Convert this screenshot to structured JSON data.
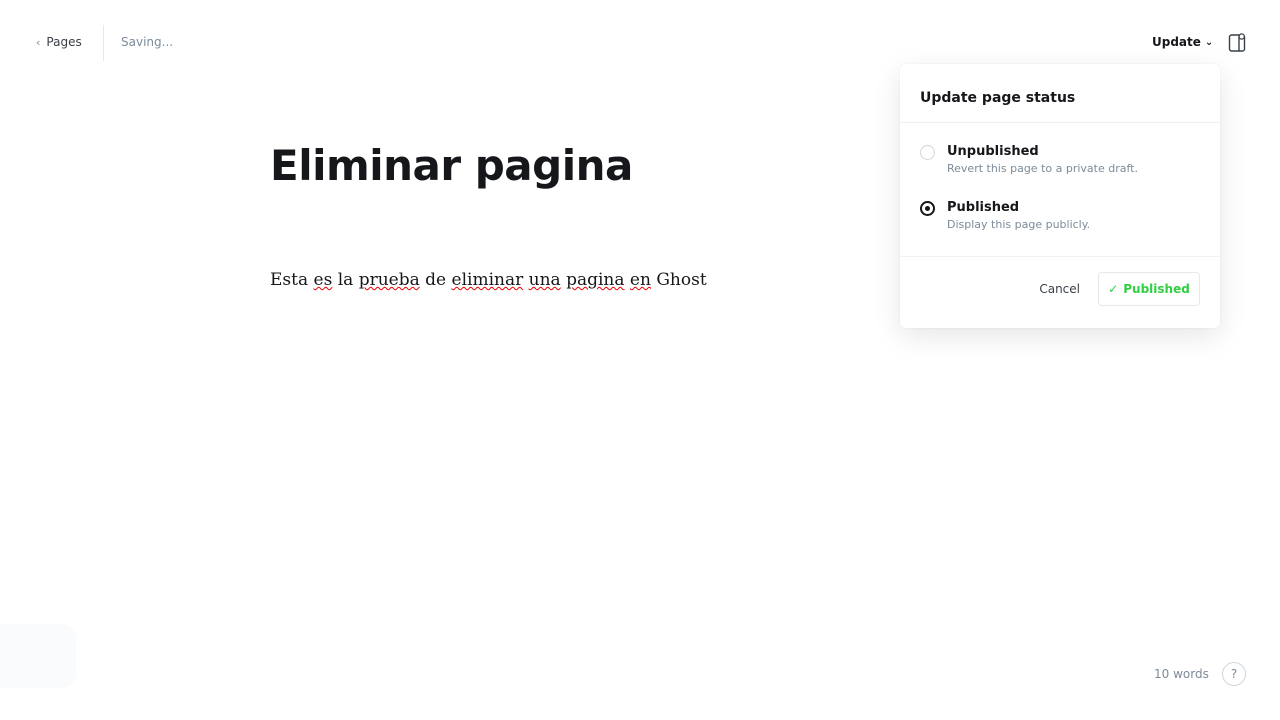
{
  "header": {
    "back_label": "Pages",
    "status": "Saving...",
    "update_label": "Update"
  },
  "popover": {
    "title": "Update page status",
    "options": [
      {
        "label": "Unpublished",
        "desc": "Revert this page to a private draft.",
        "selected": false
      },
      {
        "label": "Published",
        "desc": "Display this page publicly.",
        "selected": true
      }
    ],
    "cancel_label": "Cancel",
    "published_label": "Published"
  },
  "editor": {
    "title": "Eliminar pagina",
    "body_words": [
      "Esta",
      "es",
      "la",
      "prueba",
      "de",
      "eliminar",
      "una",
      "pagina",
      "en",
      "Ghost"
    ],
    "body": "Esta es la prueba de eliminar una pagina en Ghost"
  },
  "footer": {
    "word_count": "10 words",
    "help_label": "?"
  },
  "colors": {
    "accent_green": "#30cf43",
    "text_dark": "#15171a",
    "muted": "#7c8b9a"
  }
}
